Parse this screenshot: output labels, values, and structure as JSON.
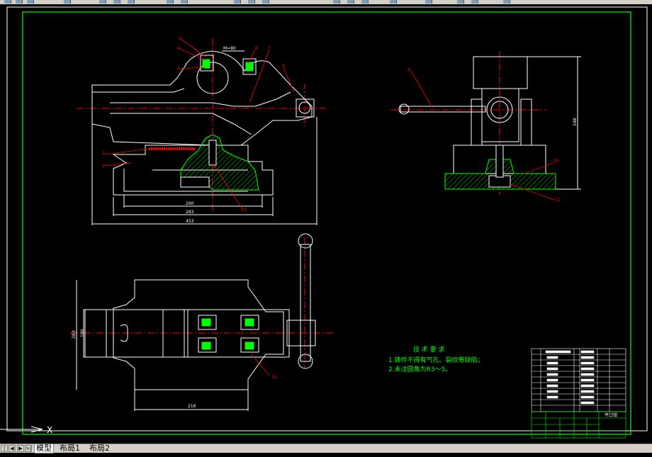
{
  "tabs": {
    "items": [
      {
        "label": "模型"
      },
      {
        "label": "布局1"
      },
      {
        "label": "布局2"
      }
    ]
  },
  "ucs": {
    "x_label": "X"
  },
  "drawing": {
    "colors": {
      "frame": "#00ff00",
      "lines": "#ffffff",
      "leader": "#ff0000",
      "center": "#ff0000",
      "hatch": "#00ff00",
      "dims": "#ffffff",
      "notes": "#00ff00"
    },
    "front_view": {
      "dim_total": "453",
      "dim_mid": "283",
      "dim_inner": "260",
      "dim_top": "M=80",
      "balloons": [
        "5",
        "4",
        "3",
        "6",
        "7",
        "8",
        "2",
        "1",
        "14"
      ]
    },
    "side_view": {
      "dim_height": "248",
      "balloons": [
        "9",
        "10",
        "11"
      ]
    },
    "top_view": {
      "dim_height": "283",
      "dim_inner": "180",
      "dim_width": "216",
      "balloons": [
        "15"
      ]
    },
    "tech_notes": {
      "title": "技 术 要 求",
      "line1": "1.铸件不得有气孔、裂纹等缺陷；",
      "line2": "2.未注圆角为R3～5。"
    },
    "title_block": {
      "drawing_name": "平口钳"
    }
  }
}
